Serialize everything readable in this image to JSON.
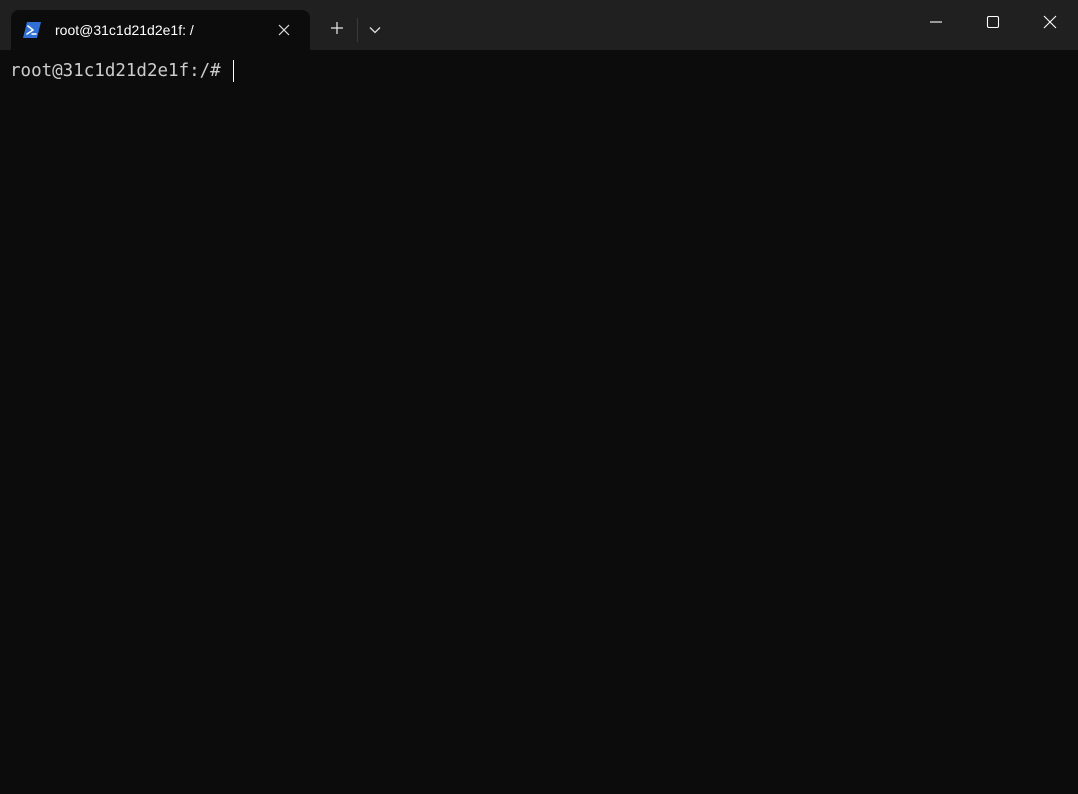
{
  "window": {
    "tabs": [
      {
        "title": "root@31c1d21d2e1f: /",
        "icon": "powershell-icon",
        "active": true
      }
    ],
    "new_tab_icon": "plus-icon",
    "dropdown_icon": "chevron-down-icon",
    "caption_buttons": [
      "minimize-icon",
      "maximize-icon",
      "close-icon"
    ]
  },
  "terminal": {
    "prompt": "root@31c1d21d2e1f:/#",
    "input": ""
  },
  "colors": {
    "titlebar": "#202020",
    "background": "#0c0c0c",
    "foreground": "#cccccc",
    "icon_accent": "#2f6fd6"
  }
}
